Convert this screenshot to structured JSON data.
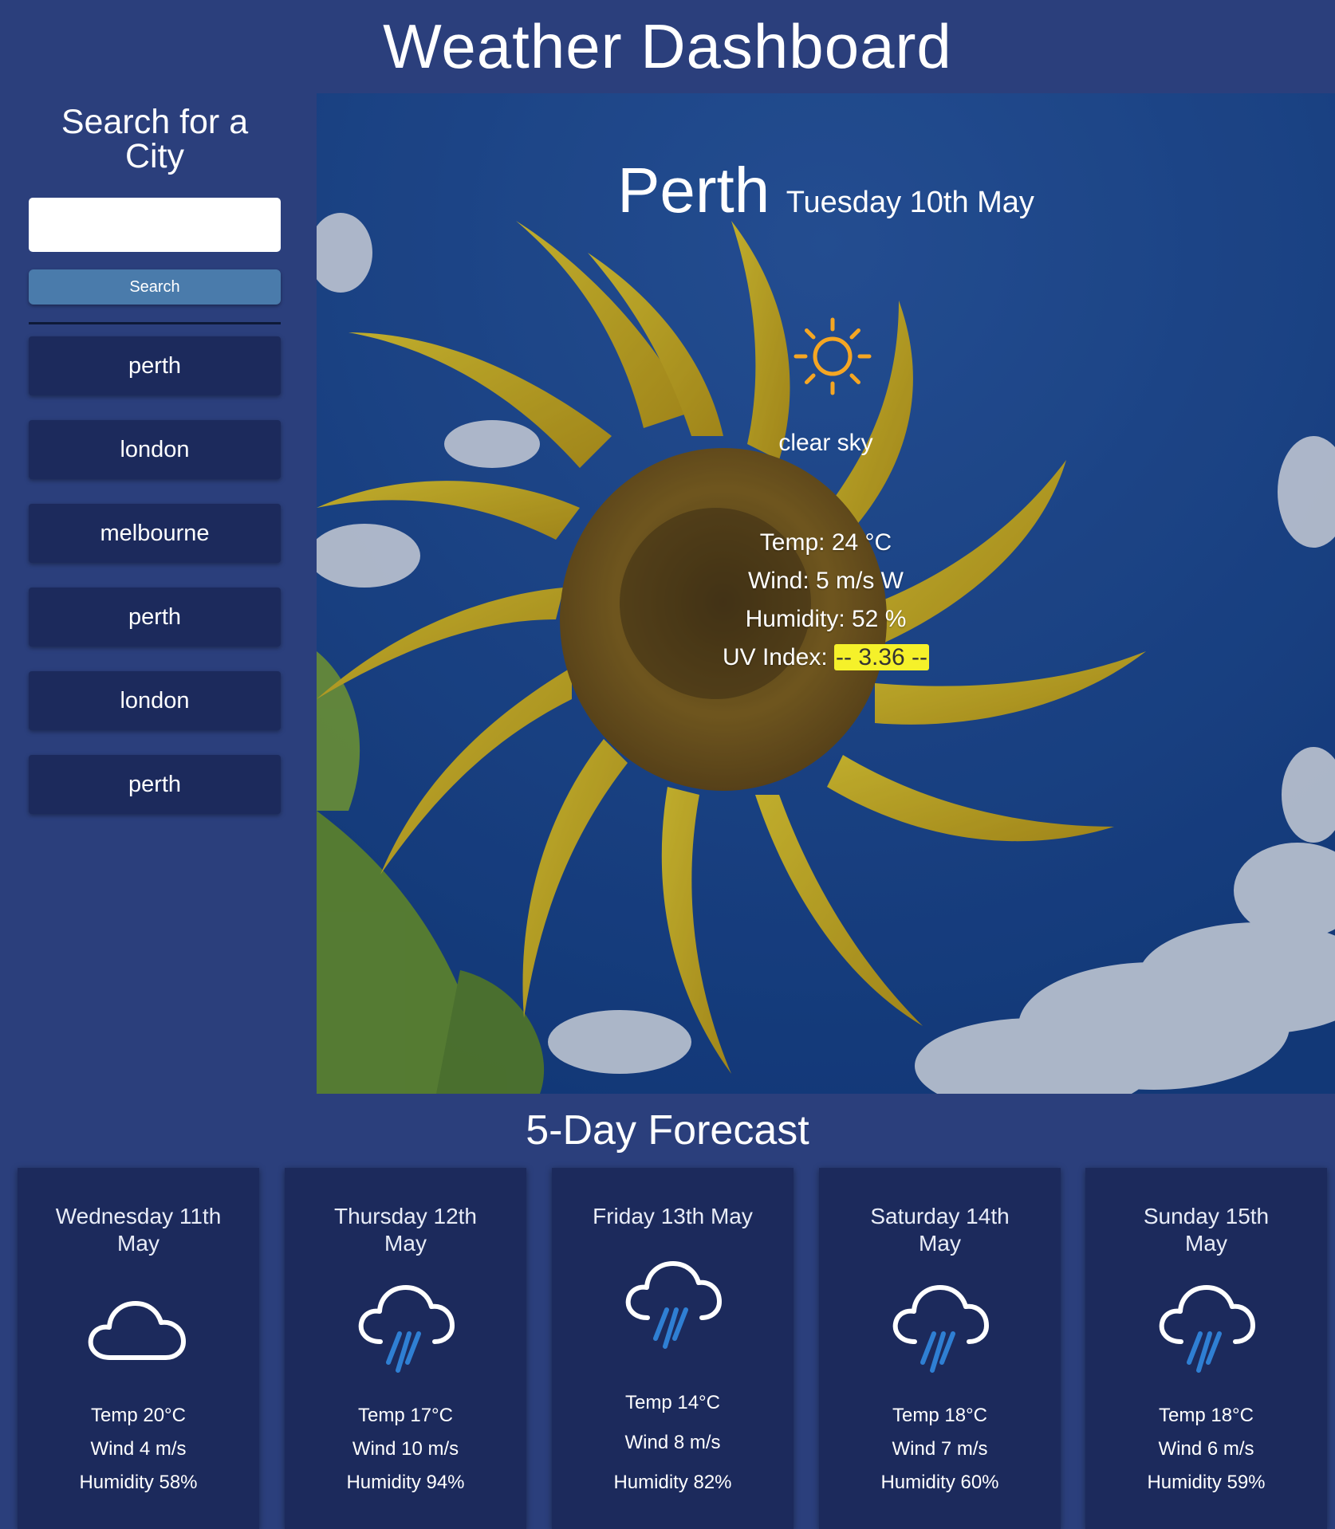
{
  "app": {
    "title": "Weather Dashboard"
  },
  "sidebar": {
    "title": "Search for a City",
    "search_placeholder": "",
    "search_value": "",
    "search_button": "Search",
    "history": [
      "perth",
      "london",
      "melbourne",
      "perth",
      "london",
      "perth"
    ]
  },
  "current": {
    "city": "Perth",
    "date": "Tuesday 10th May",
    "icon": "sun-icon",
    "condition": "clear sky",
    "temp": "Temp: 24 °C",
    "wind": "Wind: 5 m/s W",
    "humidity": "Humidity: 52 %",
    "uv_label": "UV Index:",
    "uv_value": "-- 3.36 --",
    "uv_color": "#f5f12a"
  },
  "forecast": {
    "title": "5-Day Forecast",
    "days": [
      {
        "date_line1": "Wednesday 11th",
        "date_line2": "May",
        "icon": "cloud-icon",
        "temp": "Temp 20°C",
        "wind": "Wind 4 m/s",
        "humidity": "Humidity 58%"
      },
      {
        "date_line1": "Thursday 12th",
        "date_line2": "May",
        "icon": "rain-cloud-icon",
        "temp": "Temp 17°C",
        "wind": "Wind 10 m/s",
        "humidity": "Humidity 94%"
      },
      {
        "date_line1": "Friday 13th May",
        "date_line2": "",
        "icon": "rain-cloud-icon",
        "temp": "Temp 14°C",
        "wind": "Wind 8 m/s",
        "humidity": "Humidity 82%"
      },
      {
        "date_line1": "Saturday 14th",
        "date_line2": "May",
        "icon": "rain-cloud-icon",
        "temp": "Temp 18°C",
        "wind": "Wind 7 m/s",
        "humidity": "Humidity 60%"
      },
      {
        "date_line1": "Sunday 15th",
        "date_line2": "May",
        "icon": "rain-cloud-icon",
        "temp": "Temp 18°C",
        "wind": "Wind 6 m/s",
        "humidity": "Humidity 59%"
      }
    ]
  },
  "colors": {
    "page_bg": "#2b3f7c",
    "card_bg": "#1c2a5c",
    "search_button_bg": "#4a7bab",
    "sun": "#f5a623",
    "rain": "#2f7fd3"
  }
}
